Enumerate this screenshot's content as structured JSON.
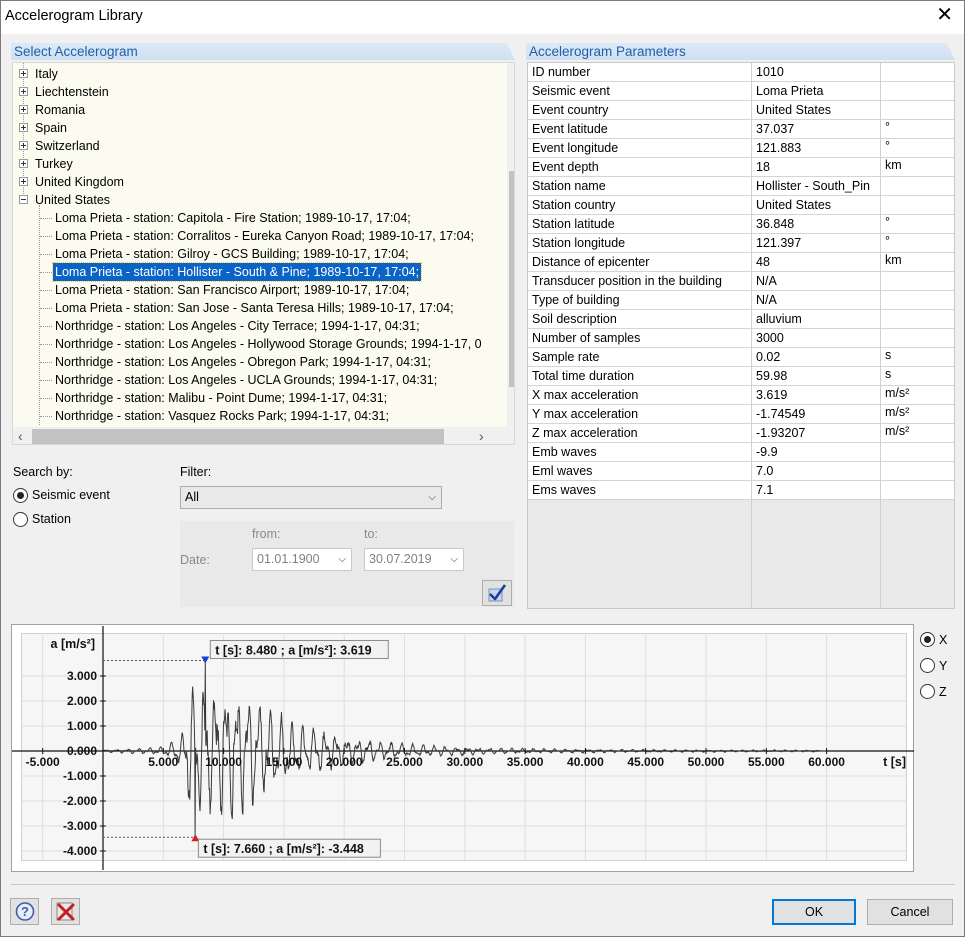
{
  "window": {
    "title": "Accelerogram Library",
    "close_glyph": "✕"
  },
  "select_panel": {
    "title": "Select Accelerogram",
    "tree": {
      "countries": [
        "Italy",
        "Liechtenstein",
        "Romania",
        "Spain",
        "Switzerland",
        "Turkey",
        "United Kingdom",
        "United States"
      ],
      "expanded_country": "United States",
      "records": [
        "Loma Prieta - station: Capitola - Fire Station; 1989-10-17, 17:04;",
        "Loma Prieta - station: Corralitos - Eureka Canyon Road; 1989-10-17, 17:04;",
        "Loma Prieta - station: Gilroy - GCS Building; 1989-10-17, 17:04;",
        "Loma Prieta - station: Hollister - South & Pine; 1989-10-17, 17:04;",
        "Loma Prieta - station: San Francisco Airport; 1989-10-17, 17:04;",
        "Loma Prieta - station: San Jose - Santa Teresa Hills; 1989-10-17, 17:04;",
        "Northridge - station: Los Angeles - City Terrace; 1994-1-17, 04:31;",
        "Northridge - station: Los Angeles - Hollywood Storage Grounds; 1994-1-17, 0",
        "Northridge - station: Los Angeles - Obregon Park; 1994-1-17, 04:31;",
        "Northridge - station: Los Angeles - UCLA Grounds; 1994-1-17, 04:31;",
        "Northridge - station: Malibu - Point Dume; 1994-1-17, 04:31;",
        "Northridge - station: Vasquez Rocks Park; 1994-1-17, 04:31;"
      ],
      "selected_index": 3
    },
    "search_by": {
      "label": "Search by:",
      "options": [
        "Seismic event",
        "Station"
      ],
      "selected": "Seismic event"
    },
    "filter": {
      "label": "Filter:",
      "value": "All"
    },
    "date": {
      "label": "Date:",
      "from_label": "from:",
      "to_label": "to:",
      "from": "01.01.1900",
      "to": "30.07.2019"
    }
  },
  "parameters_panel": {
    "title": "Accelerogram Parameters",
    "rows": [
      {
        "name": "ID number",
        "value": "1010",
        "unit": ""
      },
      {
        "name": "Seismic event",
        "value": "Loma Prieta",
        "unit": ""
      },
      {
        "name": "Event country",
        "value": "United States",
        "unit": ""
      },
      {
        "name": "Event latitude",
        "value": "37.037",
        "unit": "°"
      },
      {
        "name": "Event longitude",
        "value": "121.883",
        "unit": "°"
      },
      {
        "name": "Event depth",
        "value": "18",
        "unit": "km"
      },
      {
        "name": "Station name",
        "value": "Hollister - South_Pin",
        "unit": ""
      },
      {
        "name": "Station country",
        "value": "United States",
        "unit": ""
      },
      {
        "name": "Station latitude",
        "value": "36.848",
        "unit": "°"
      },
      {
        "name": "Station longitude",
        "value": "121.397",
        "unit": "°"
      },
      {
        "name": "Distance of epicenter",
        "value": "48",
        "unit": "km"
      },
      {
        "name": "Transducer position in the building",
        "value": "N/A",
        "unit": ""
      },
      {
        "name": "Type of building",
        "value": "N/A",
        "unit": ""
      },
      {
        "name": "Soil description",
        "value": "alluvium",
        "unit": ""
      },
      {
        "name": "Number of samples",
        "value": "3000",
        "unit": ""
      },
      {
        "name": "Sample rate",
        "value": "0.02",
        "unit": "s"
      },
      {
        "name": "Total time duration",
        "value": "59.98",
        "unit": "s"
      },
      {
        "name": "X max acceleration",
        "value": "3.619",
        "unit": "m/s²"
      },
      {
        "name": "Y max acceleration",
        "value": "-1.74549",
        "unit": "m/s²"
      },
      {
        "name": "Z max acceleration",
        "value": "-1.93207",
        "unit": "m/s²"
      },
      {
        "name": "Emb waves",
        "value": "-9.9",
        "unit": ""
      },
      {
        "name": "Eml waves",
        "value": "7.0",
        "unit": ""
      },
      {
        "name": "Ems waves",
        "value": "7.1",
        "unit": ""
      }
    ]
  },
  "direction": {
    "options": [
      "X",
      "Y",
      "Z"
    ],
    "selected": "X"
  },
  "chart_data": {
    "type": "line",
    "xlabel": "t [s]",
    "ylabel": "a [m/s²]",
    "xlim": [
      -5,
      60
    ],
    "ylim": [
      -4,
      3.6
    ],
    "x_ticks": [
      "-5.000",
      "5.000",
      "10.000",
      "15.000",
      "20.000",
      "25.000",
      "30.000",
      "35.000",
      "40.000",
      "45.000",
      "50.000",
      "55.000",
      "60.000"
    ],
    "y_ticks": [
      "3.000",
      "2.000",
      "1.000",
      "0.000",
      "-1.000",
      "-2.000",
      "-3.000",
      "-4.000"
    ],
    "max": {
      "t": 8.48,
      "a": 3.619,
      "label": "t [s]: 8.480 ; a [m/s²]: 3.619"
    },
    "min": {
      "t": 7.66,
      "a": -3.448,
      "label": "t [s]: 7.660 ; a [m/s²]: -3.448"
    },
    "series": [
      {
        "values": []
      }
    ],
    "colors": {
      "signal": "#3a3a3a",
      "max_marker": "#1f3fd0",
      "min_marker": "#d02020"
    }
  },
  "buttons": {
    "ok": "OK",
    "cancel": "Cancel",
    "help_icon": "help-icon",
    "delete_icon": "delete-icon"
  }
}
